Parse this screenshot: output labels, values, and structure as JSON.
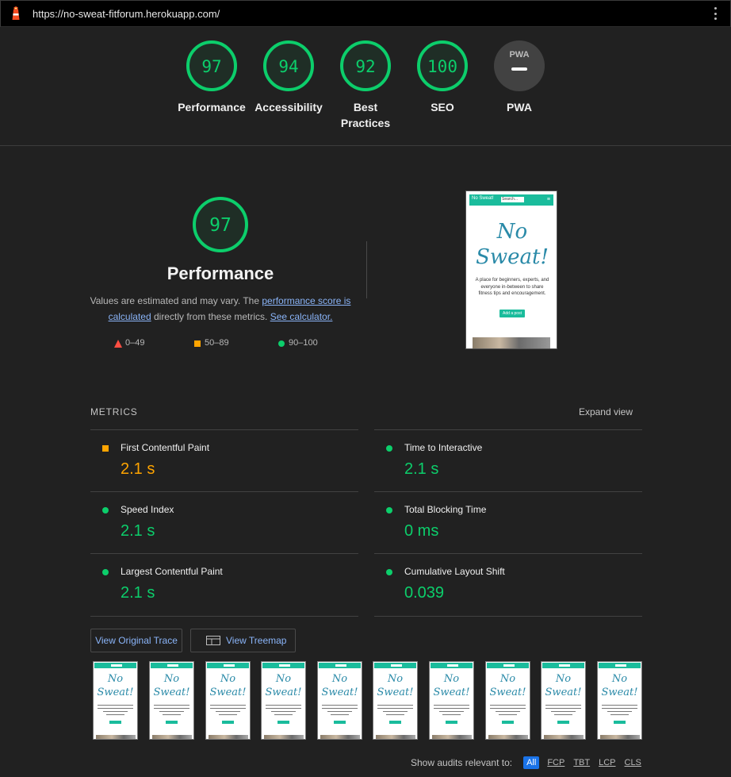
{
  "header": {
    "url": "https://no-sweat-fitforum.herokuapp.com/",
    "logo_icon": "lighthouse-icon",
    "menu_icon": "kebab-menu-icon"
  },
  "categories": [
    {
      "label": "Performance",
      "score": "97"
    },
    {
      "label": "Accessibility",
      "score": "94"
    },
    {
      "label": "Best Practices",
      "score": "92"
    },
    {
      "label": "SEO",
      "score": "100"
    },
    {
      "label": "PWA",
      "badge": "PWA",
      "score": ""
    }
  ],
  "performance": {
    "score": "97",
    "title": "Performance",
    "desc_prefix": "Values are estimated and may vary. The ",
    "link_score": "performance score is calculated",
    "desc_middle": " directly from these metrics. ",
    "link_calc": "See calculator.",
    "legend": [
      {
        "range": "0–49",
        "color": "#ff4e42",
        "shape": "triangle"
      },
      {
        "range": "50–89",
        "color": "#ffa400",
        "shape": "square"
      },
      {
        "range": "90–100",
        "color": "#0cce6b",
        "shape": "circle"
      }
    ]
  },
  "screenshot": {
    "brand": "No Sweat!",
    "search_placeholder": "Search...",
    "heading_line1": "No",
    "heading_line2": "Sweat!",
    "text": "A place for beginners, experts, and everyone in-between to share fitness tips and encouragement.",
    "button": "Add a post"
  },
  "metrics": {
    "title": "METRICS",
    "expand": "Expand view",
    "items": [
      {
        "name": "First Contentful Paint",
        "value": "2.1 s",
        "status": "average"
      },
      {
        "name": "Time to Interactive",
        "value": "2.1 s",
        "status": "pass"
      },
      {
        "name": "Speed Index",
        "value": "2.1 s",
        "status": "pass"
      },
      {
        "name": "Total Blocking Time",
        "value": "0 ms",
        "status": "pass"
      },
      {
        "name": "Largest Contentful Paint",
        "value": "2.1 s",
        "status": "pass"
      },
      {
        "name": "Cumulative Layout Shift",
        "value": "0.039",
        "status": "pass"
      }
    ]
  },
  "buttons": {
    "trace": "View Original Trace",
    "treemap": "View Treemap",
    "treemap_icon": "treemap-icon"
  },
  "filter": {
    "label": "Show audits relevant to:",
    "chips": [
      "All",
      "FCP",
      "TBT",
      "LCP",
      "CLS"
    ]
  },
  "colors": {
    "pass": "#0cce6b",
    "average": "#ffa400",
    "fail": "#ff4e42",
    "link": "#8ab4f8"
  }
}
